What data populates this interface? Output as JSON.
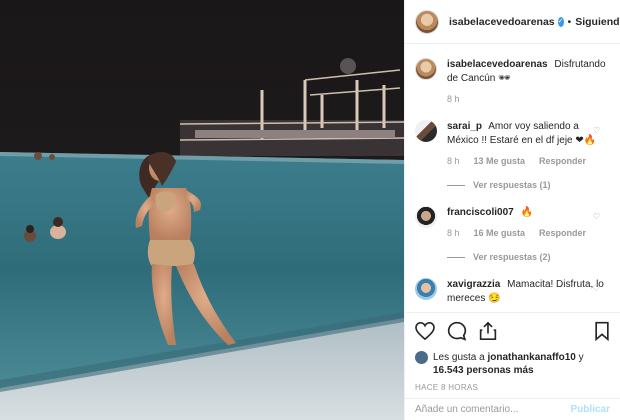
{
  "post": {
    "username": "isabelacevedoarenas",
    "verified_mark": "✓",
    "separator": "•",
    "follow_status": "Siguiendo"
  },
  "comments": [
    {
      "user": "isabelacevedoarenas",
      "text": "Disfrutando de Cancún 🕶",
      "time": "8 h",
      "likes": "",
      "reply": "",
      "view_replies": ""
    },
    {
      "user": "sarai_p",
      "text": "Amor voy saliendo a México !! Estaré en el df jeje ❤🔥",
      "time": "8 h",
      "likes": "13 Me gusta",
      "reply": "Responder",
      "view_replies": "Ver respuestas (1)"
    },
    {
      "user": "franciscoli007",
      "text": "🔥",
      "time": "8 h",
      "likes": "16 Me gusta",
      "reply": "Responder",
      "view_replies": "Ver respuestas (2)"
    },
    {
      "user": "xavigrazzia",
      "text": "Mamacita! Disfruta, lo mereces 😏",
      "time": "8 h",
      "likes": "",
      "reply": "",
      "view_replies": ""
    }
  ],
  "likes": {
    "prefix": "Les gusta a",
    "user": "jonathankanaffo10",
    "joiner": "y",
    "others": "16.543 personas más"
  },
  "timestamp": "HACE 8 HORAS",
  "comment_box": {
    "placeholder": "Añade un comentario...",
    "publish": "Publicar"
  },
  "icons": {
    "like": "heart-icon",
    "comment": "comment-icon",
    "share": "share-icon",
    "save": "bookmark-icon"
  },
  "colors": {
    "verified": "#3897f0",
    "publish": "#b2dffc",
    "fire": "#ff6a00"
  }
}
